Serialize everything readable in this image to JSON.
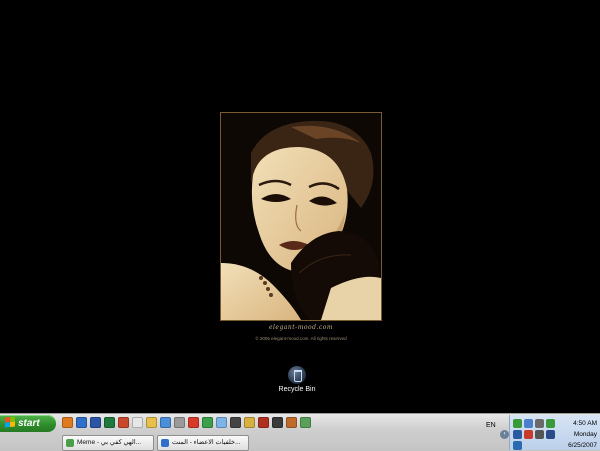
{
  "wallpaper": {
    "site": "elegant-mood.com",
    "copyright": "© 2006 elegant-mood.com. All rights reserved"
  },
  "desktop_icons": [
    {
      "label": "Recycle Bin",
      "icon": "recycle-bin-icon"
    }
  ],
  "taskbar": {
    "start_label": "start",
    "quicklaunch": [
      {
        "icon": "firefox-icon",
        "color": "#e07a1f"
      },
      {
        "icon": "ie-icon",
        "color": "#2f6fc9"
      },
      {
        "icon": "word-icon",
        "color": "#2a55a5"
      },
      {
        "icon": "excel-icon",
        "color": "#1e7a3c"
      },
      {
        "icon": "powerpoint-icon",
        "color": "#c9472a"
      },
      {
        "icon": "notepad-icon",
        "color": "#e6e6e6"
      },
      {
        "icon": "explorer-icon",
        "color": "#e6c04a"
      },
      {
        "icon": "network-icon",
        "color": "#4a8fd9"
      },
      {
        "icon": "dvd-icon",
        "color": "#9a9a9a"
      },
      {
        "icon": "media-icon",
        "color": "#d83a2a"
      },
      {
        "icon": "paint-icon",
        "color": "#3aa04a"
      },
      {
        "icon": "messenger-icon",
        "color": "#7ab4e8"
      },
      {
        "icon": "winamp-icon",
        "color": "#444444"
      },
      {
        "icon": "app-icon",
        "color": "#d8b040"
      },
      {
        "icon": "recorder-icon",
        "color": "#b03020"
      },
      {
        "icon": "game-icon",
        "color": "#3a3a3a"
      },
      {
        "icon": "tool-icon",
        "color": "#c06a2a"
      },
      {
        "icon": "network-tray-icon",
        "color": "#5aa05a"
      }
    ],
    "tasks": [
      {
        "label": "Meme - الهي كفي بي...",
        "icon": "messenger-task-icon",
        "color": "#4aa04a"
      },
      {
        "label": "خلفيات الاعضاء - المنت...",
        "icon": "ie-task-icon",
        "color": "#2f6fc9"
      }
    ],
    "language": "EN",
    "tray_icons": [
      {
        "icon": "security-icon",
        "color": "#3a9a3a"
      },
      {
        "icon": "network-icon",
        "color": "#4a7fc9"
      },
      {
        "icon": "volume-icon",
        "color": "#6a6a6a"
      },
      {
        "icon": "messenger-tray-icon",
        "color": "#3a9a3a"
      },
      {
        "icon": "shield-icon",
        "color": "#2a5aa0"
      },
      {
        "icon": "update-icon",
        "color": "#c93a2a"
      },
      {
        "icon": "printer-icon",
        "color": "#555555"
      },
      {
        "icon": "monitor-icon",
        "color": "#2a4a8a"
      },
      {
        "icon": "chat-icon",
        "color": "#2a6ab0"
      }
    ],
    "clock": {
      "time": "4:50 AM",
      "day": "Monday",
      "date": "6/25/2007"
    }
  }
}
